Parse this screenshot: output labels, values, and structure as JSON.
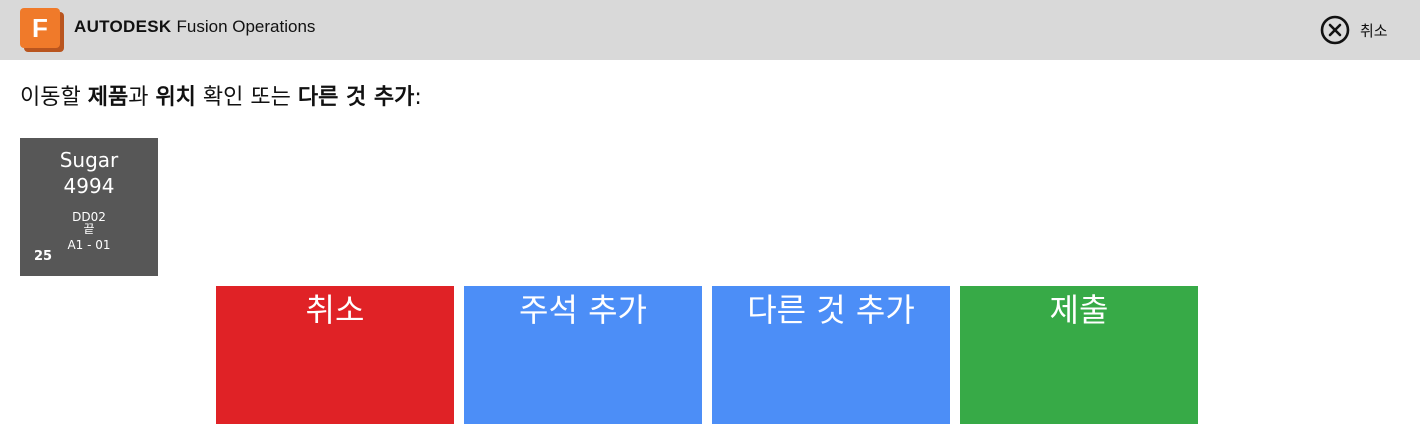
{
  "header": {
    "logo_letter": "F",
    "brand_bold": "AUTODESK",
    "brand_rest": "Fusion Operations",
    "cancel_label": "취소",
    "cancel_icon": "close-circle-icon"
  },
  "instruction": {
    "p1": "이동할 ",
    "b1": "제품",
    "p2": "과 ",
    "b2": "위치",
    "p3": " 확인 또는 ",
    "b3": "다른 것 추가",
    "p4": ":"
  },
  "item": {
    "name": "Sugar",
    "code": "4994",
    "line1": "DD02",
    "line2": "끝",
    "line3": "A1 - 01",
    "quantity": "25"
  },
  "actions": {
    "cancel": "취소",
    "add_note": "주석 추가",
    "add_other": "다른 것 추가",
    "submit": "제출"
  },
  "colors": {
    "header_bg": "#d9d9d9",
    "logo_orange": "#f07a2a",
    "tile_bg": "#575757",
    "cancel_red": "#e02226",
    "action_blue": "#4c8ef7",
    "submit_green": "#37aa47"
  }
}
